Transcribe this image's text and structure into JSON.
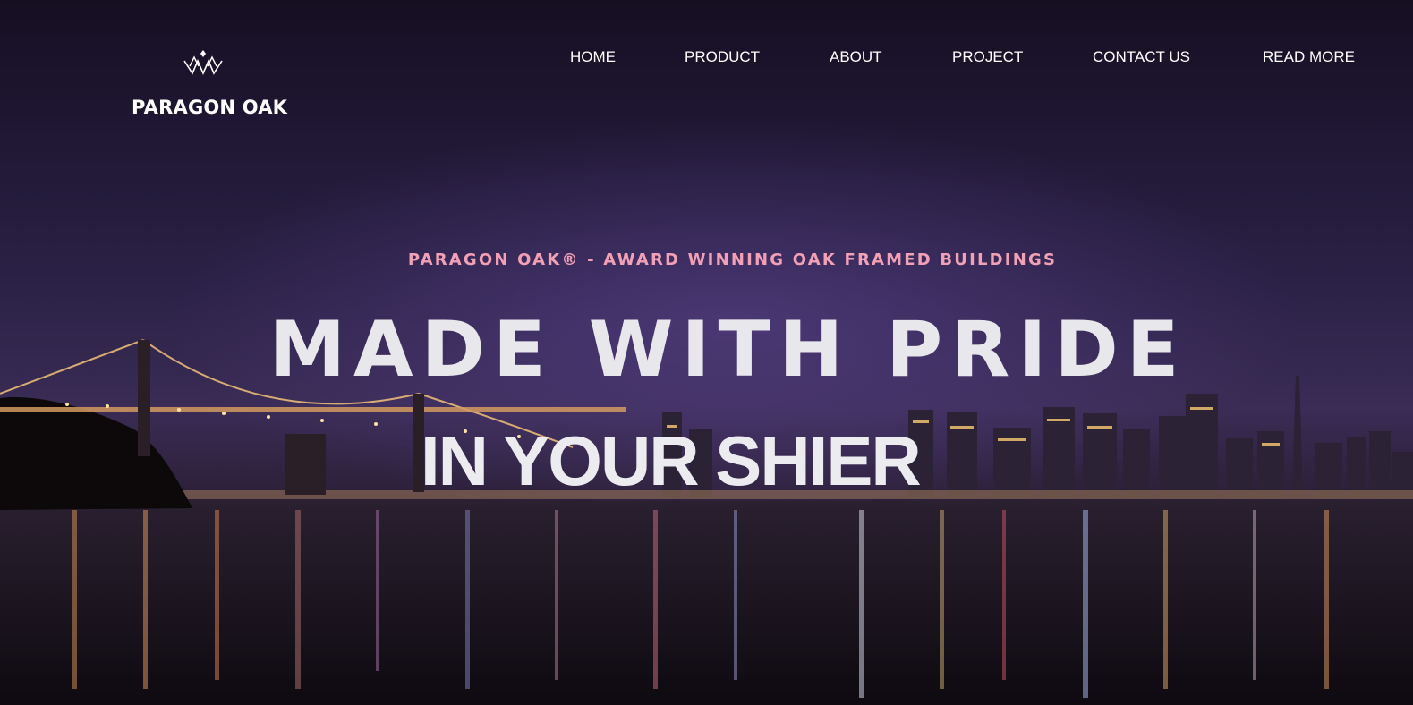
{
  "brand": {
    "name": "PARAGON OAK",
    "logo_icon": "crown-icon"
  },
  "nav": {
    "items": [
      {
        "label": "HOME"
      },
      {
        "label": "PRODUCT"
      },
      {
        "label": "ABOUT"
      },
      {
        "label": "PROJECT"
      },
      {
        "label": "CONTACT US"
      },
      {
        "label": "READ MORE"
      }
    ]
  },
  "hero": {
    "tagline": "PARAGON OAK® - AWARD WINNING OAK FRAMED BUILDINGS",
    "headline_line1": "MADE WITH PRIDE",
    "headline_line2": "IN YOUR SHIER",
    "background_image": "night city skyline with suspension bridge reflected on water"
  },
  "colors": {
    "accent": "#f2a0b6",
    "text": "#ffffff",
    "sky_top": "#160f22",
    "sky_mid": "#3a2c55"
  }
}
